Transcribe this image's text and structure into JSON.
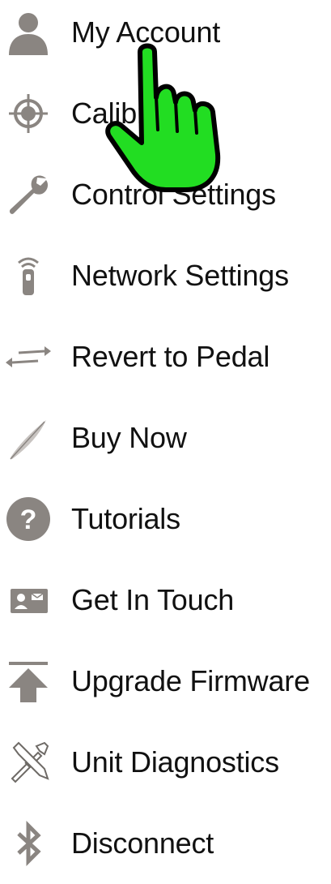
{
  "menu": {
    "items": [
      {
        "label": "My Account",
        "icon": "person-icon"
      },
      {
        "label": "Calibrate",
        "icon": "crosshair-icon"
      },
      {
        "label": "Control Settings",
        "icon": "wrench-icon"
      },
      {
        "label": "Network Settings",
        "icon": "wireless-remote-icon"
      },
      {
        "label": "Revert to Pedal",
        "icon": "swap-arrows-icon"
      },
      {
        "label": "Buy Now",
        "icon": "feather-icon"
      },
      {
        "label": "Tutorials",
        "icon": "question-circle-icon"
      },
      {
        "label": "Get In Touch",
        "icon": "contact-card-icon"
      },
      {
        "label": "Upgrade Firmware",
        "icon": "upload-arrow-icon"
      },
      {
        "label": "Unit Diagnostics",
        "icon": "tools-icon"
      },
      {
        "label": "Disconnect",
        "icon": "bluetooth-icon"
      }
    ]
  },
  "colors": {
    "icon_gray": "#8a8581",
    "text": "#111111",
    "hand_fill": "#22dd22",
    "hand_outline": "#000000"
  },
  "overlay": {
    "icon": "pointing-hand-cursor-icon"
  }
}
